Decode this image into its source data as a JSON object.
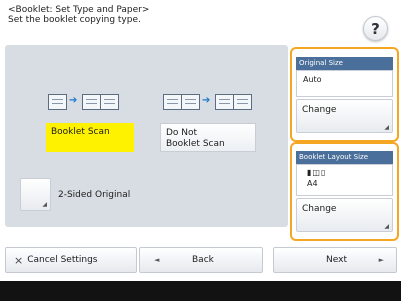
{
  "header": {
    "line1": "<Booklet: Set Type and Paper>",
    "line2": "Set the booklet copying type.",
    "help_label": "?"
  },
  "options": {
    "booklet_scan_label": "Booklet Scan",
    "no_booklet_line1": "Do Not",
    "no_booklet_line2": "Booklet Scan",
    "selected": "Booklet Scan"
  },
  "two_sided": {
    "label": "2-Sided Original"
  },
  "original_size": {
    "heading": "Original Size",
    "value": "Auto",
    "change_label": "Change"
  },
  "layout_size": {
    "heading": "Booklet Layout Size",
    "paper_icons": "▮◫▯",
    "value": "A4",
    "change_label": "Change"
  },
  "footer": {
    "cancel_label": "Cancel Settings",
    "cancel_icon": "×",
    "back_label": "Back",
    "back_icon": "◄",
    "next_label": "Next",
    "next_icon": "►"
  },
  "colors": {
    "selected": "#fef200",
    "accent_frame": "#f5a623",
    "heading_blue": "#4a6f9a",
    "panel_bg": "#d8dde4"
  }
}
